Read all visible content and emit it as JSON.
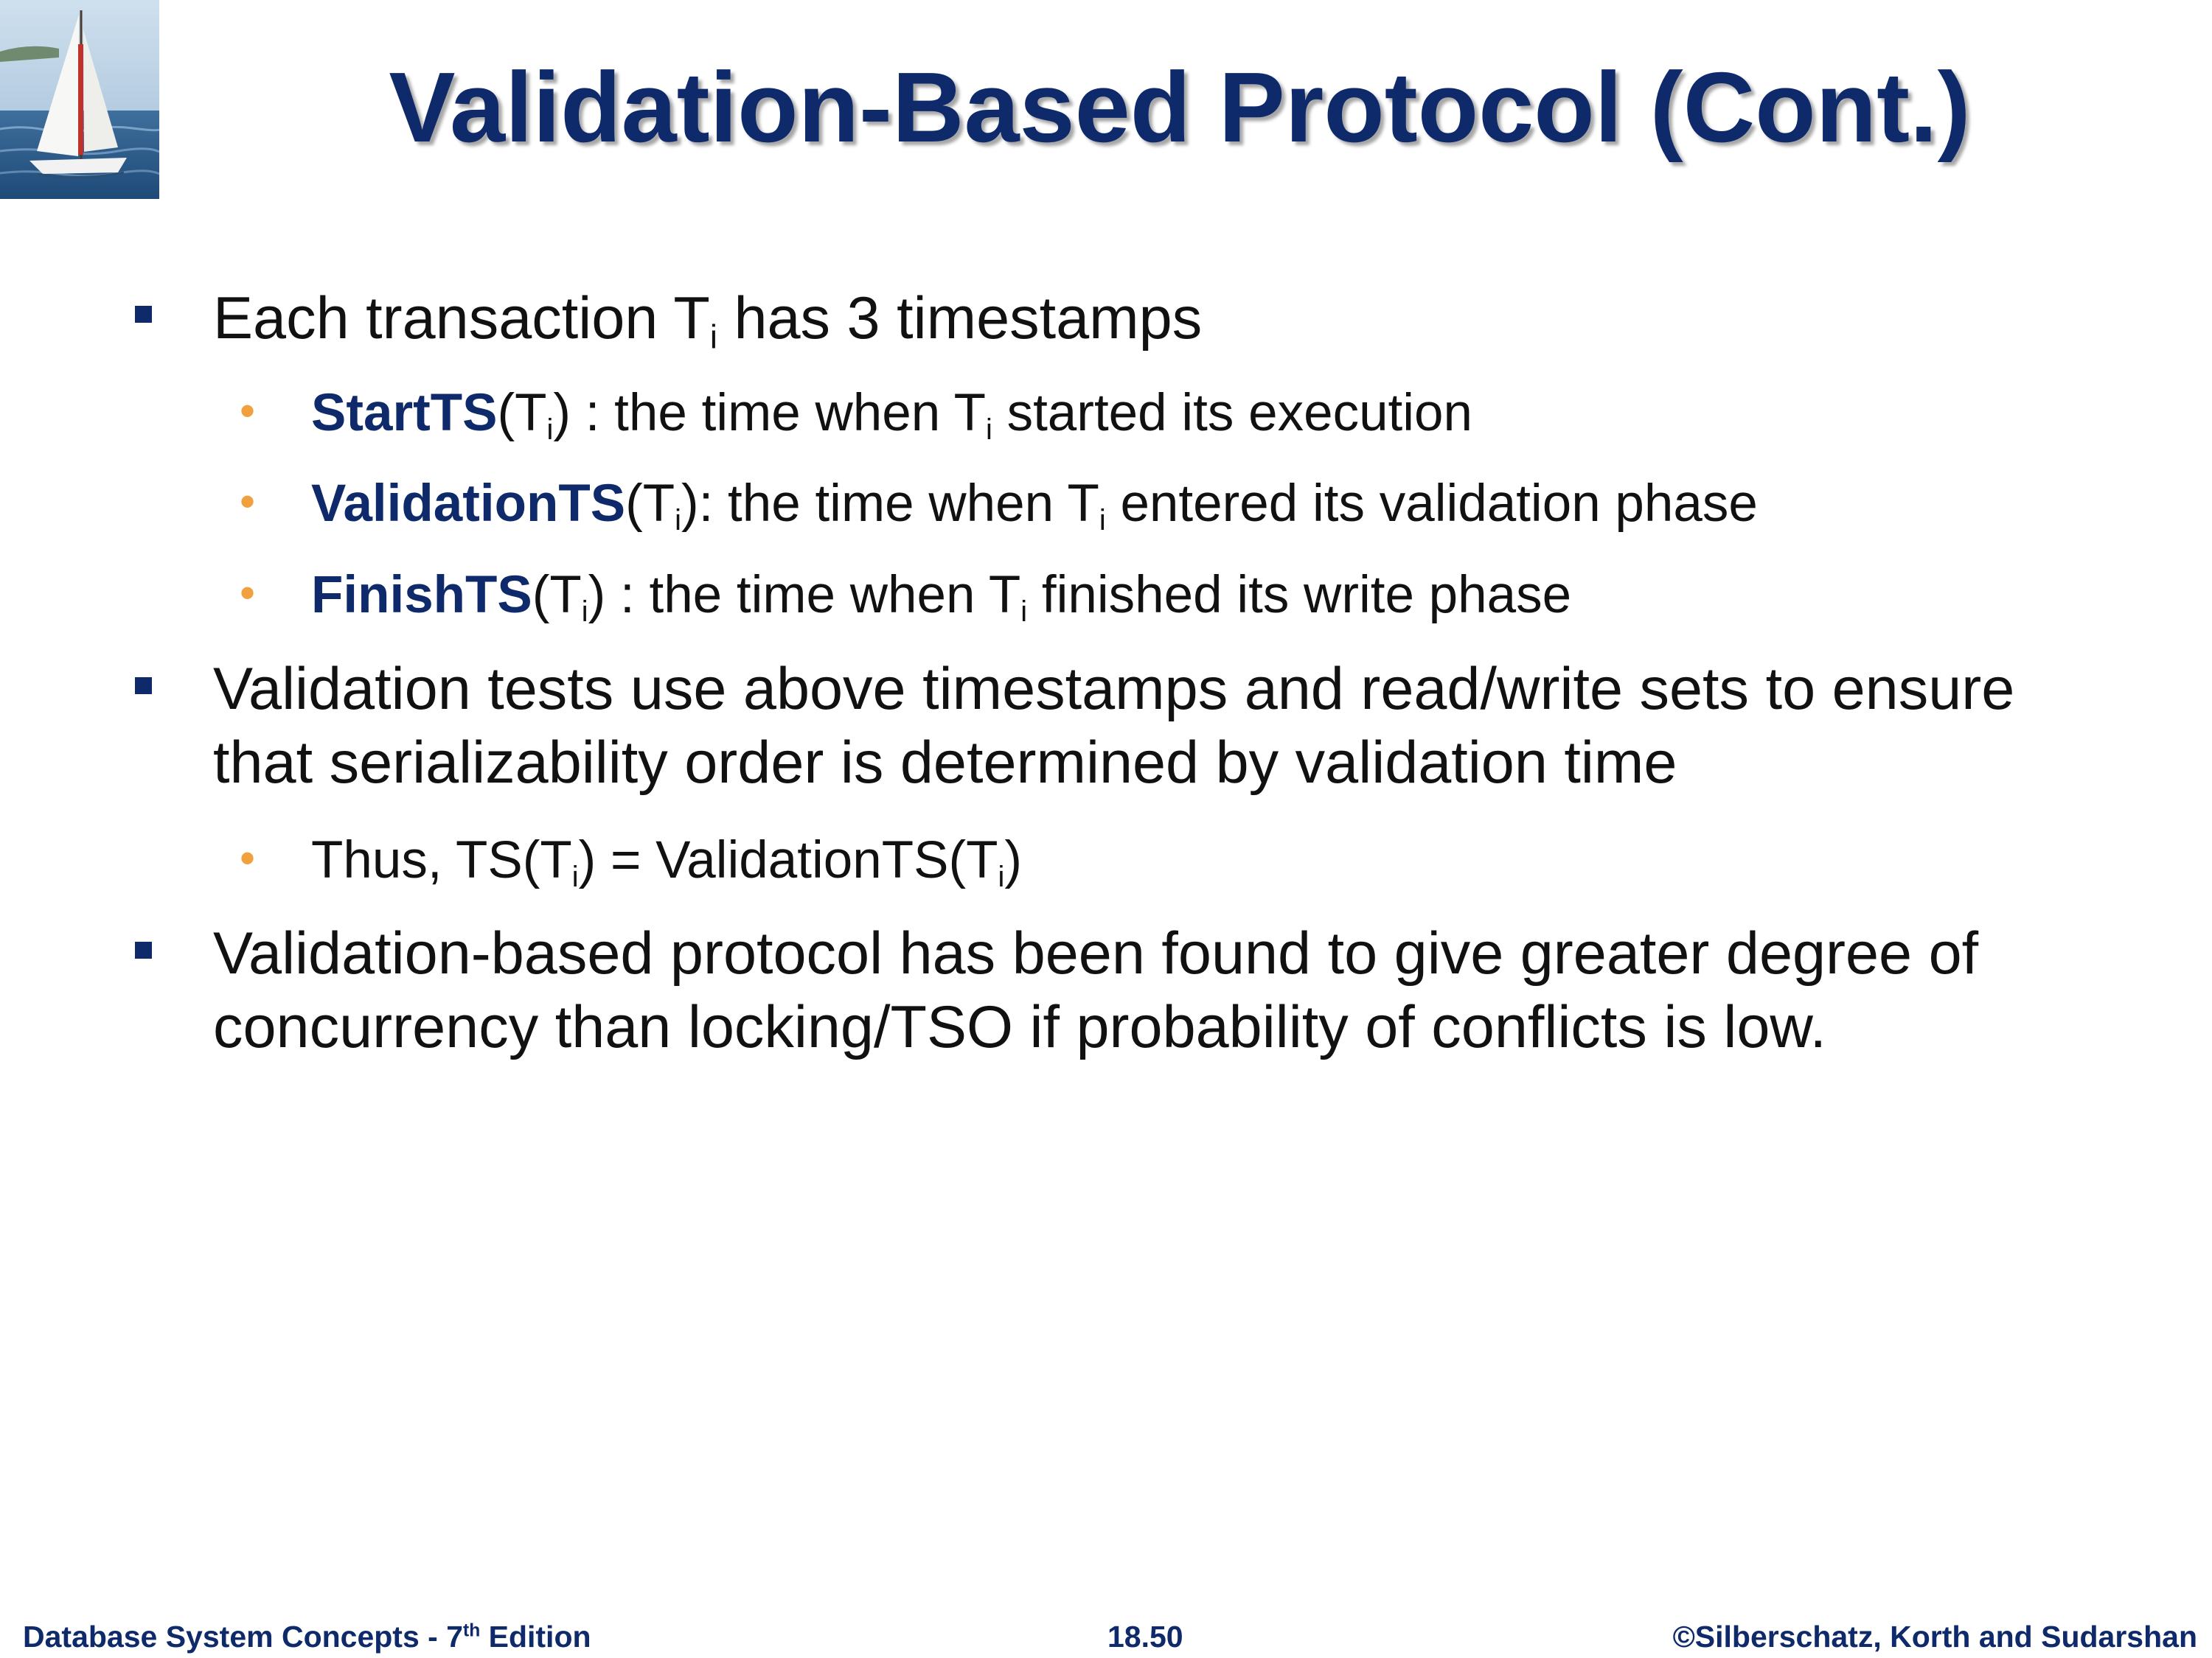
{
  "title": "Validation-Based Protocol (Cont.)",
  "logo": {
    "icon": "sailboat-photo"
  },
  "bullets": [
    {
      "before": "Each transaction T",
      "sub": "i",
      "after": " has 3 timestamps",
      "children": [
        {
          "term": "StartTS",
          "t1": "(T",
          "s1": "i",
          "t2": ") : the time when T",
          "s2": "i",
          "t3": " started its execution"
        },
        {
          "term": "ValidationTS",
          "t1": "(T",
          "s1": "i",
          "t2": "): the time when T",
          "s2": "i",
          "t3": " entered its validation phase"
        },
        {
          "term": "FinishTS",
          "t1": "(T",
          "s1": "i",
          "t2": ") : the time when T",
          "s2": "i",
          "t3": " finished its write phase"
        }
      ]
    },
    {
      "line1": "Validation tests use above timestamps and read/write sets to ensure",
      "line2": "that serializability order is determined by validation time",
      "children": [
        {
          "t1": "Thus, TS(T",
          "s1": "i",
          "t2": ") = ValidationTS(T",
          "s2": "i",
          "t3": ")"
        }
      ]
    },
    {
      "line1": "Validation-based protocol has been found to give greater degree of",
      "line2": "concurrency than locking/TSO if probability of conflicts is low."
    }
  ],
  "footer": {
    "left_prefix": "Database System Concepts - 7",
    "left_sup": "th",
    "left_suffix": " Edition",
    "center": "18.50",
    "right": "©Silberschatz, Korth and Sudarshan"
  },
  "colors": {
    "title": "#0f2a6b",
    "term": "#0f2a6b",
    "square_bullet": "#0f2a6b",
    "round_bullet": "#f0a03c",
    "footer": "#0f2a6b"
  }
}
